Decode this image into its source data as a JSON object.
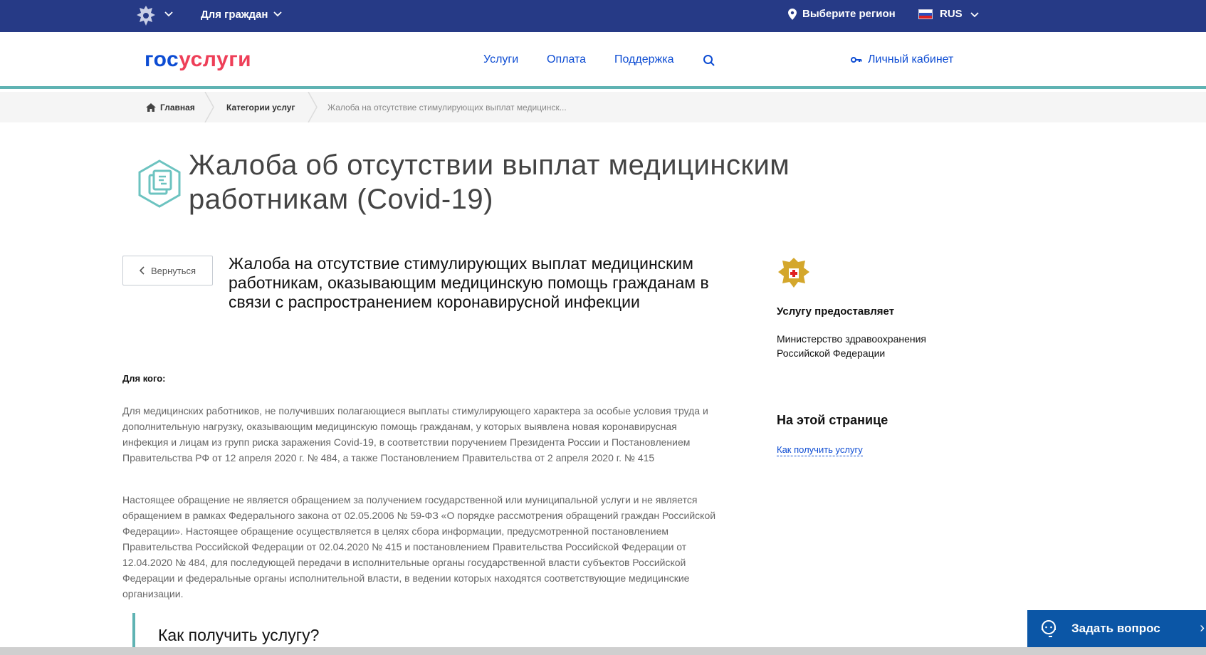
{
  "topbar": {
    "citizens_label": "Для граждан",
    "region_label": "Выберите регион",
    "lang_label": "RUS"
  },
  "header": {
    "logo_part1": "гос",
    "logo_part2": "услуги",
    "nav": [
      "Услуги",
      "Оплата",
      "Поддержка"
    ],
    "cabinet_label": "Личный кабинет"
  },
  "breadcrumb": {
    "home": "Главная",
    "category": "Категории услуг",
    "current": "Жалоба на отсутствие стимулирующих выплат медицинск..."
  },
  "page": {
    "title": "Жалоба об отсутствии выплат медицинским работникам (Covid-19)",
    "back_label": "Вернуться",
    "subtitle": "Жалоба на отсутствие стимулирующих выплат медицинским работникам, оказывающим медицинскую помощь гражданам в связи с распространением коронавирусной инфекции",
    "who_label": "Для кого:",
    "paragraph1": "Для медицинских работников, не получивших полагающиеся выплаты стимулирующего характера за особые условия труда и дополнительную нагрузку, оказывающим медицинскую помощь гражданам, у которых выявлена новая коронавирусная инфекция и лицам из групп риска заражения Covid-19, в соответствии поручением Президента России и Постановлением Правительства РФ от 12 апреля 2020 г. № 484, а также Постановлением Правительства от 2 апреля 2020 г. № 415",
    "paragraph2": "Настоящее обращение не является обращением за получением государственной или муниципальной услуги и не является обращением в рамках Федерального закона от 02.05.2006 № 59-ФЗ «О порядке рассмотрения обращений граждан Российской Федерации». Настоящее обращение осуществляется в целях сбора информации, предусмотренной постановлением Правительства Российской Федерации от 02.04.2020 № 415 и постановлением Правительства Российской Федерации от 12.04.2020 № 484, для последующей передачи в исполнительные органы государственной власти субъектов Российской Федерации и федеральные органы исполнительной власти, в ведении которых находятся соответствующие медицинские организации.",
    "howto_title": "Как получить услугу?"
  },
  "sidebar": {
    "provides_label": "Услугу предоставляет",
    "provider_name": "Министерство здравоохранения Российской Федерации",
    "onpage_title": "На этой странице",
    "onpage_link": "Как получить услугу"
  },
  "ask": {
    "label": "Задать вопрос",
    "close": "›"
  },
  "colors": {
    "topbar": "#263a86",
    "link": "#0d4cd3",
    "logo_red": "#ee3f58",
    "accent_teal": "#5fb3b3",
    "ask_button": "#0b56a6"
  },
  "icons": [
    "emblem-icon",
    "chevron-down-icon",
    "location-pin-icon",
    "flag-icon",
    "search-icon",
    "key-icon",
    "home-icon",
    "service-icon",
    "chevron-left-icon",
    "ministry-emblem-icon",
    "chat-support-icon"
  ]
}
